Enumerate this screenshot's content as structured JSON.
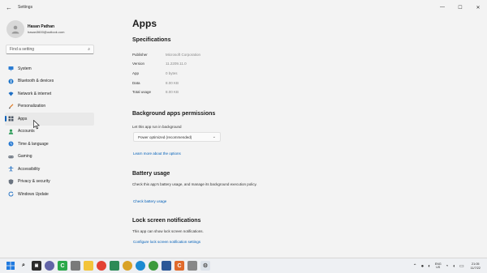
{
  "window": {
    "app_title": "Settings",
    "controls": {
      "minimize": "—",
      "maximize": "☐",
      "close": "✕"
    }
  },
  "profile": {
    "name": "Hasan Pathan",
    "email": "hasan3600@outlook.com"
  },
  "search": {
    "placeholder": "Find a setting"
  },
  "nav": [
    {
      "label": "System",
      "icon": "monitor-icon",
      "active": false
    },
    {
      "label": "Bluetooth & devices",
      "icon": "bluetooth-icon",
      "active": false
    },
    {
      "label": "Network & internet",
      "icon": "wifi-icon",
      "active": false
    },
    {
      "label": "Personalization",
      "icon": "brush-icon",
      "active": false
    },
    {
      "label": "Apps",
      "icon": "apps-icon",
      "active": true
    },
    {
      "label": "Accounts",
      "icon": "person-icon",
      "active": false
    },
    {
      "label": "Time & language",
      "icon": "globe-clock-icon",
      "active": false
    },
    {
      "label": "Gaming",
      "icon": "gamepad-icon",
      "active": false
    },
    {
      "label": "Accessibility",
      "icon": "accessibility-icon",
      "active": false
    },
    {
      "label": "Privacy & security",
      "icon": "shield-icon",
      "active": false
    },
    {
      "label": "Windows Update",
      "icon": "update-icon",
      "active": false
    }
  ],
  "main": {
    "title": "Apps",
    "specifications": {
      "heading": "Specifications",
      "rows": [
        {
          "key": "Publisher",
          "value": "Microsoft Corporation"
        },
        {
          "key": "Version",
          "value": "11.2209.11.0"
        },
        {
          "key": "App",
          "value": "0 bytes"
        },
        {
          "key": "Data",
          "value": "8.00 KB"
        },
        {
          "key": "Total usage",
          "value": "8.00 KB"
        }
      ]
    },
    "background": {
      "heading": "Background apps permissions",
      "label": "Let this app run in background",
      "selected": "Power optimized (recommended)",
      "link": "Learn more about the options"
    },
    "battery": {
      "heading": "Battery usage",
      "description": "Check this app's battery usage, and manage its background execution policy.",
      "link": "Check battery usage"
    },
    "lockscreen": {
      "heading": "Lock screen notifications",
      "description": "This app can show lock screen notifications.",
      "link": "Configure lock screen notification settings"
    }
  },
  "taskbar": {
    "lang": [
      "ENG",
      "US"
    ],
    "time": "21:05",
    "date": "11/7/22"
  }
}
